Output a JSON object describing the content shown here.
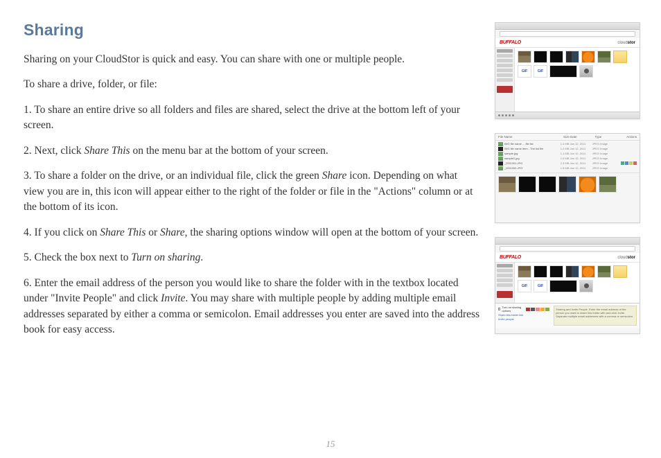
{
  "heading": "Sharing",
  "paragraphs": {
    "p_intro": "Sharing on your CloudStor is quick and easy. You can share with one or multiple people.",
    "p_lead": "To share a drive, folder, or file:",
    "p1_a": "1. To share an entire drive so all folders and files are shared, select the drive at the bottom left of your screen.",
    "p2_a": "2. Next, click ",
    "p2_i1": "Share This",
    "p2_b": " on the menu bar at the bottom of your screen.",
    "p3_a": "3. To share a folder on the drive, or an individual file, click the green ",
    "p3_i1": "Share",
    "p3_b": " icon. Depending on what view you are in, this icon will appear either to the right of the folder or file in the \"Actions\" column or at the bottom of its icon.",
    "p4_a": "4. If you click on ",
    "p4_i1": "Share This",
    "p4_b": " or ",
    "p4_i2": "Share",
    "p4_c": ", the sharing options window will open at the bottom of your screen.",
    "p5_a": "5. Check the box next to ",
    "p5_i1": "Turn on sharing",
    "p5_b": ".",
    "p6_a": "6. Enter the email address of the person you would like to share the folder with in the textbox located under \"Invite People\" and click ",
    "p6_i1": "Invite",
    "p6_b": ". You may share with multiple people by adding multiple email addresses separated by either a comma or semicolon. Email addresses you enter are saved into the address book for easy access."
  },
  "page_number": "15",
  "thumbs": {
    "brand_buffalo": "BUFFALO",
    "brand_cloud_a": "cloud",
    "brand_cloud_b": "stor",
    "list_headers": {
      "c1": "File Name",
      "c2": "Size   Date",
      "c3": "Type",
      "c4": "Actions"
    },
    "list_rows": [
      {
        "name": "IMG file name ... file list",
        "meta": "1.4 MB   Jan 12, 2011",
        "type": "JPEG Image"
      },
      {
        "name": "IMG file name item - The list file",
        "meta": "1.2 MB   Jan 12, 2011",
        "type": "JPEG Image"
      },
      {
        "name": "sample.jpg",
        "meta": "1.1 MB   Jan 12, 2011",
        "type": "JPEG Image"
      },
      {
        "name": "sample2.jpg",
        "meta": "1.0 MB   Jan 12, 2011",
        "type": "JPEG Image"
      },
      {
        "name": "_DSC001.JPG",
        "meta": "2.3 MB   Jan 12, 2011",
        "type": "JPEG Image"
      },
      {
        "name": "_DSC002.JPG",
        "meta": "1.9 MB   Jan 12, 2011",
        "type": "JPEG Image"
      }
    ],
    "file_label": "GIF",
    "share_panel": {
      "turn_on": "Turn on sharing options",
      "link_a": "Share this folder link",
      "link_b": "Invite people",
      "note": "Sharing and Invite People. Enter the email address of the person you want to share this folder with and click Invite. Separate multiple email addresses with a comma or semicolon."
    }
  }
}
